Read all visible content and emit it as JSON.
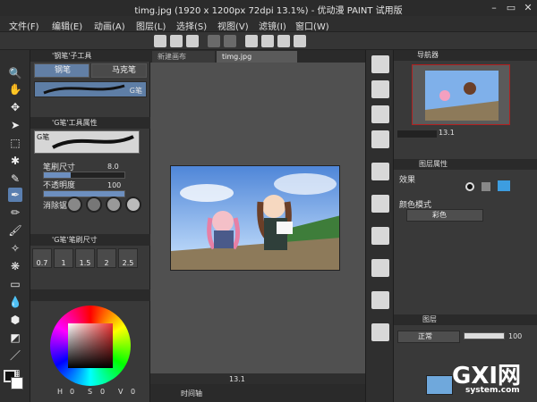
{
  "window": {
    "title": "timg.jpg (1920 x 1200px 72dpi 13.1%)  - 优动漫 PAINT 试用版"
  },
  "menu": [
    "文件(F)",
    "编辑(E)",
    "动画(A)",
    "图层(L)",
    "选择(S)",
    "视图(V)",
    "滤镜(I)",
    "窗口(W)"
  ],
  "subtool": {
    "header": "'钢笔'子工具",
    "tabs": [
      "钢笔",
      "马克笔"
    ],
    "selected_brush": "G笔",
    "props_header": "'G笔'工具属性",
    "props_brush": "G笔",
    "brush_size_label": "笔刷尺寸",
    "brush_size_value": "8.0",
    "opacity_label": "不透明度",
    "opacity_value": "100",
    "aa_label": "消除锯齿",
    "size_header": "'G笔'笔刷尺寸",
    "sizes": [
      "0.7",
      "1",
      "1.5",
      "2",
      "2.5"
    ],
    "color_values": [
      "H",
      "0",
      "S",
      "0",
      "V",
      "0"
    ]
  },
  "canvas": {
    "tabs": [
      "新建画布",
      "timg.jpg"
    ],
    "zoom": "13.1",
    "timeline_label": "时间轴"
  },
  "navigator": {
    "tab": "导航器",
    "zoom": "13.1"
  },
  "layer_props": {
    "tab": "图层属性",
    "effect_label": "效果",
    "color_mode_label": "颜色模式",
    "color_mode_value": "彩色"
  },
  "layers": {
    "tab": "图层",
    "blend_mode": "正常",
    "opacity": "100"
  },
  "watermark": {
    "main": "GXI网",
    "sub": "system.com"
  },
  "colors": {
    "accent": "#5a7fb0",
    "panel": "#393939",
    "dark": "#2a2a2a"
  }
}
